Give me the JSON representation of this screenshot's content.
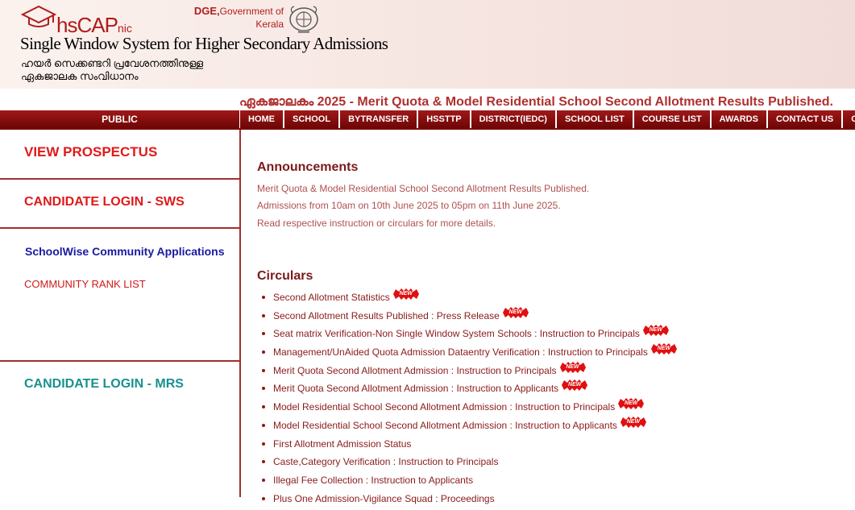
{
  "header": {
    "logo_hs": "hs",
    "logo_cap": "CAP",
    "logo_nic": "nic",
    "dge_bold": "DGE,",
    "dge_rest": "Government of Kerala",
    "title": "Single Window System for Higher Secondary Admissions",
    "subtitle_line1": "ഹയർ സെക്കണ്ടറി പ്രവേശനത്തിനുള്ള",
    "subtitle_line2": "ഏകജാലക സംവിധാനം"
  },
  "marquee": "ഏകജാലകം 2025 - Merit Quota & Model Residential School Second Allotment Results Published.",
  "nav": {
    "public_label": "PUBLIC",
    "items": [
      "HOME",
      "SCHOOL",
      "BYTRANSFER",
      "HSSTTP",
      "DISTRICT(IEDC)",
      "SCHOOL LIST",
      "COURSE LIST",
      "AWARDS",
      "CONTACT US",
      "CO"
    ]
  },
  "sidebar": {
    "view_prospectus": "VIEW PROSPECTUS",
    "candidate_login_sws": "CANDIDATE LOGIN - SWS",
    "schoolwise_community": "SchoolWise Community Applications",
    "community_rank_list": "COMMUNITY RANK LIST",
    "candidate_login_mrs": "CANDIDATE LOGIN - MRS"
  },
  "announcements": {
    "heading": "Announcements",
    "lines": [
      "Merit Quota & Model Residential School Second Allotment Results Published.",
      "Admissions from 10am on 10th June 2025 to 05pm on 11th June 2025.",
      "Read respective instruction or circulars for more details."
    ]
  },
  "circulars": {
    "heading": "Circulars",
    "new_label": "NEW",
    "new_color": "#e01010",
    "items": [
      {
        "text": "Second Allotment Statistics",
        "is_new": true
      },
      {
        "text": "Second Allotment Results Published : Press Release",
        "is_new": true
      },
      {
        "text": "Seat matrix Verification-Non Single Window System Schools : Instruction to Principals",
        "is_new": true
      },
      {
        "text": "Management/UnAided Quota Admission Dataentry Verification : Instruction to Principals",
        "is_new": true
      },
      {
        "text": "Merit Quota Second Allotment Admission : Instruction to Principals",
        "is_new": true
      },
      {
        "text": "Merit Quota Second Allotment Admission : Instruction to Applicants",
        "is_new": true
      },
      {
        "text": "Model Residential School Second Allotment Admission : Instruction to Principals",
        "is_new": true
      },
      {
        "text": "Model Residential School Second Allotment Admission : Instruction to Applicants",
        "is_new": true
      },
      {
        "text": "First Allotment Admission Status",
        "is_new": false
      },
      {
        "text": "Caste,Category Verification : Instruction to Principals",
        "is_new": false
      },
      {
        "text": "Illegal Fee Collection : Instruction to Applicants",
        "is_new": false
      },
      {
        "text": "Plus One Admission-Vigilance Squad : Proceedings",
        "is_new": false
      }
    ]
  }
}
